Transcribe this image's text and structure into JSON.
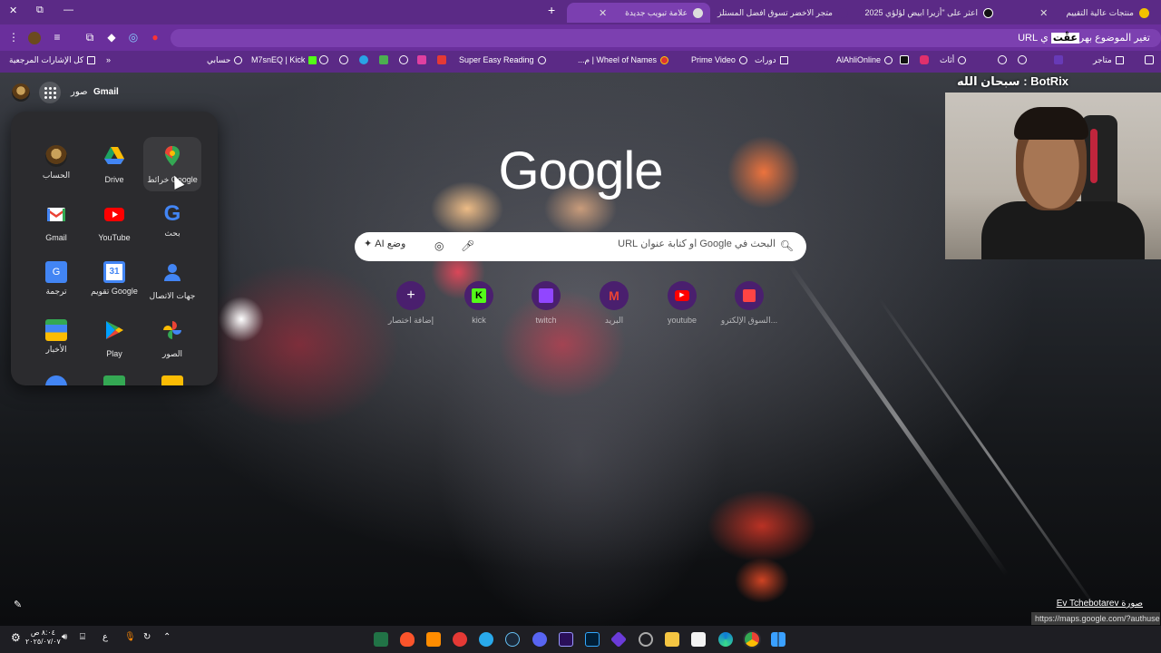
{
  "tabs": [
    {
      "label": "منتجات عالية التقييم",
      "favicon_color": "#f2c200"
    },
    {
      "label": "اعثر على \"أزيرا ابيض لؤلؤي 2025",
      "favicon_color": "#ffffff"
    },
    {
      "label": "متجر الاخضر تسوق افضل المستلز",
      "favicon_color": "#5b2a86"
    },
    {
      "label": "علامة تبويب جديدة",
      "favicon_color": "#dddddd",
      "active": true
    }
  ],
  "window_controls": {
    "close": "✕",
    "restore": "⧉",
    "minimize": "—"
  },
  "omnibox": {
    "text_before": "تغير الموضوع بهر",
    "highlight": "عقْت",
    "text_after": "ي URL"
  },
  "bookmarks": [
    "كل الإشارات المرجعية",
    "حسابي",
    "M7snEQ | Kick",
    "Super Easy Reading",
    "Wheel of Names | م...",
    "Prime Video",
    "دورات",
    "AlAhliOnline",
    "أثاث",
    "متاجر"
  ],
  "google_bar": {
    "gmail": "Gmail",
    "images": "صور"
  },
  "apps": [
    {
      "label": "الحساب",
      "icon": "account-icon"
    },
    {
      "label": "Drive",
      "icon": "drive-icon"
    },
    {
      "label": "خرائط Google",
      "icon": "maps-icon"
    },
    {
      "label": "Gmail",
      "icon": "gmail-icon"
    },
    {
      "label": "YouTube",
      "icon": "youtube-icon"
    },
    {
      "label": "بحث",
      "icon": "google-search-icon"
    },
    {
      "label": "ترجمة",
      "icon": "translate-icon"
    },
    {
      "label": "تقويم Google",
      "icon": "calendar-icon"
    },
    {
      "label": "جهات الاتصال",
      "icon": "contacts-icon"
    },
    {
      "label": "الأخبار",
      "icon": "news-icon"
    },
    {
      "label": "Play",
      "icon": "play-icon"
    },
    {
      "label": "الصور",
      "icon": "photos-icon"
    }
  ],
  "logo": "Google",
  "search": {
    "placeholder": "البحث في Google أو كتابة عنوان URL",
    "ai_mode": "وضع AI"
  },
  "shortcuts": [
    {
      "label": "إضافة اختصار",
      "icon": "plus-icon"
    },
    {
      "label": "kick",
      "icon": "kick-icon"
    },
    {
      "label": "twitch",
      "icon": "twitch-icon"
    },
    {
      "label": "البريد",
      "icon": "gmail-icon"
    },
    {
      "label": "youtube",
      "icon": "youtube-icon"
    },
    {
      "label": "السوق الإلكترو...",
      "icon": "store-icon"
    }
  ],
  "overlay": {
    "title": "سبحان الله : BotRix"
  },
  "photo_credit": "صورة Ev Tchebotarev",
  "status_url": "https://maps.google.com/?authuser=0",
  "clock": {
    "time": "٨:٠٤ ص",
    "date": "٢٠٢٥/٠٧/٠٧"
  },
  "taskbar_lang": "ع",
  "colors": {
    "tabstrip": "#5b2a86",
    "toolbar": "#6a2f9c",
    "omnibox": "#7c40b0",
    "apps_panel": "#2b2b2e",
    "taskbar": "#1e1e23"
  }
}
